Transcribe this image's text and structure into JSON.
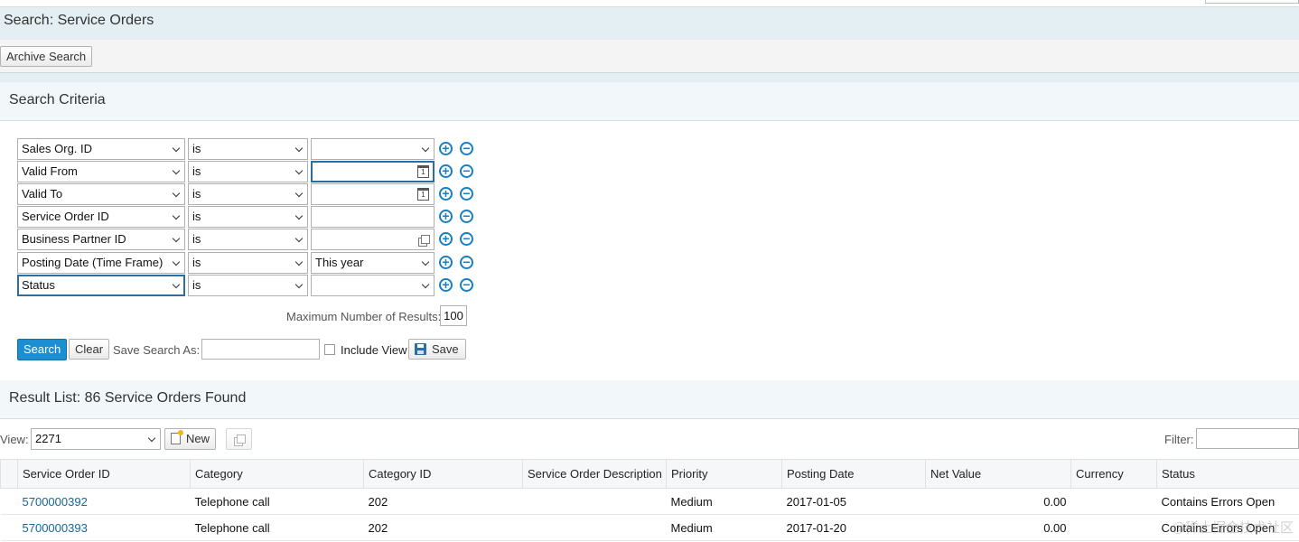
{
  "page": {
    "title": "Search: Service Orders",
    "archive_search_label": "Archive Search"
  },
  "criteria": {
    "title": "Search Criteria",
    "rows": [
      {
        "field": "Sales Org. ID",
        "operator": "is",
        "value": "",
        "value_type": "dropdown"
      },
      {
        "field": "Valid From",
        "operator": "is",
        "value": "",
        "value_type": "date"
      },
      {
        "field": "Valid To",
        "operator": "is",
        "value": "",
        "value_type": "date"
      },
      {
        "field": "Service Order ID",
        "operator": "is",
        "value": "",
        "value_type": "text"
      },
      {
        "field": "Business Partner ID",
        "operator": "is",
        "value": "",
        "value_type": "valuehelp"
      },
      {
        "field": "Posting Date (Time Frame)",
        "operator": "is",
        "value": "This year",
        "value_type": "dropdown"
      },
      {
        "field": "Status",
        "operator": "is",
        "value": "",
        "value_type": "dropdown"
      }
    ],
    "max_results_label": "Maximum Number of Results:",
    "max_results_value": "100",
    "search_label": "Search",
    "clear_label": "Clear",
    "save_search_as_label": "Save Search As:",
    "save_search_as_value": "",
    "include_view_label": "Include View",
    "save_label": "Save"
  },
  "results": {
    "title": "Result List: 86 Service Orders Found",
    "view_label": "View:",
    "view_value": "2271",
    "new_label": "New",
    "filter_label": "Filter:",
    "filter_value": "",
    "columns": [
      "Service Order ID",
      "Category",
      "Category ID",
      "Service Order Description",
      "Priority",
      "Posting Date",
      "Net Value",
      "Currency",
      "Status"
    ],
    "rows": [
      {
        "id": "5700000392",
        "category": "Telephone call",
        "category_id": "202",
        "description": "",
        "priority": "Medium",
        "posting_date": "2017-01-05",
        "net_value": "0.00",
        "currency": "",
        "status": "Contains Errors Open"
      },
      {
        "id": "5700000393",
        "category": "Telephone call",
        "category_id": "202",
        "description": "",
        "priority": "Medium",
        "posting_date": "2017-01-20",
        "net_value": "0.00",
        "currency": "",
        "status": "Contains Errors Open"
      }
    ]
  },
  "watermark": "@稀土掘金技术社区"
}
